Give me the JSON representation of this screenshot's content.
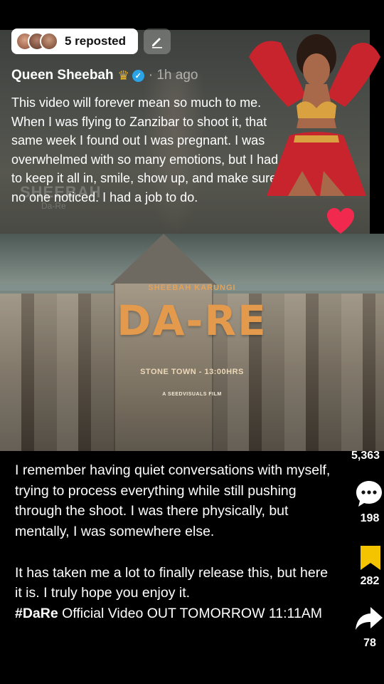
{
  "repost": {
    "label": "5 reposted"
  },
  "author": {
    "name": "Queen Sheebah",
    "time_ago": "· 1h ago"
  },
  "post": {
    "text": "This video will forever mean so much to me. When I was flying to Zanzibar to shoot it, that same week I found out I was pregnant. I was overwhelmed with so many emotions, but I had to keep it all in, smile, show up, and make sure no one noticed. I had a job to do."
  },
  "video": {
    "credit_top": "SHEEBAH KARUNGI",
    "title": "DA-RE",
    "subtitle": "STONE TOWN - 13:00HRS",
    "credit_bottom": "A SEEDVISUALS FILM"
  },
  "caption": {
    "paragraph1": "I remember having quiet conversations with myself, trying to process everything while still pushing through the shoot. I was there physically, but mentally, I was somewhere else.",
    "paragraph2": "It has taken me a lot to finally release this, but here it is. I truly hope you enjoy it.",
    "hashtag": "#DaRe",
    "paragraph3": " Official Video OUT TOMORROW 11:11AM"
  },
  "rail": {
    "likes": "5,363",
    "comments": "198",
    "bookmarks": "282",
    "shares": "78"
  },
  "colors": {
    "heart": "#f2294f",
    "bookmark": "#f5c400",
    "title_orange": "#e39a4c",
    "verified": "#2aa4e6"
  },
  "icons": [
    "edit-icon",
    "crown-icon",
    "verified-icon",
    "heart-icon",
    "comment-icon",
    "bookmark-icon",
    "share-icon"
  ]
}
